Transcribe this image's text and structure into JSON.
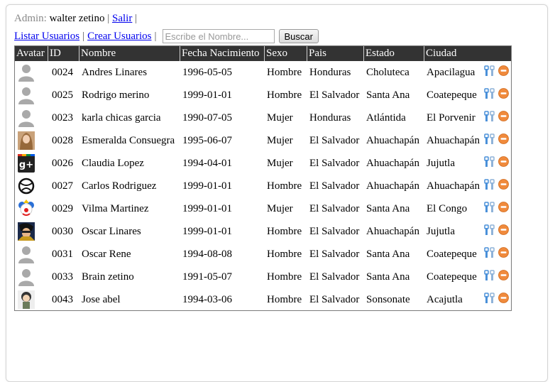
{
  "header": {
    "admin_label": "Admin:",
    "admin_name": "walter zetino",
    "separator": "|",
    "logout_link": "Salir"
  },
  "nav": {
    "list_users": "Listar Usuarios",
    "create_users": "Crear Usuarios",
    "search_placeholder": "Escribe el Nombre...",
    "search_value": "",
    "search_button": "Buscar"
  },
  "table": {
    "columns": [
      "Avatar",
      "ID",
      "Nombre",
      "Fecha Nacimiento",
      "Sexo",
      "Pais",
      "Estado",
      "Ciudad"
    ],
    "rows": [
      {
        "avatar": "default-user-icon",
        "id": "0024",
        "nombre": "Andres Linares",
        "fecha": "1996-05-05",
        "sexo": "Hombre",
        "pais": "Honduras",
        "estado": "Choluteca",
        "ciudad": "Apacilagua"
      },
      {
        "avatar": "default-user-icon",
        "id": "0025",
        "nombre": "Rodrigo merino",
        "fecha": "1999-01-01",
        "sexo": "Hombre",
        "pais": "El Salvador",
        "estado": "Santa Ana",
        "ciudad": "Coatepeque"
      },
      {
        "avatar": "default-user-icon",
        "id": "0023",
        "nombre": "karla chicas garcia",
        "fecha": "1990-07-05",
        "sexo": "Mujer",
        "pais": "Honduras",
        "estado": "Atlántida",
        "ciudad": "El Porvenir"
      },
      {
        "avatar": "woman-photo",
        "id": "0028",
        "nombre": "Esmeralda Consuegra",
        "fecha": "1995-06-07",
        "sexo": "Mujer",
        "pais": "El Salvador",
        "estado": "Ahuachapán",
        "ciudad": "Ahuachapán"
      },
      {
        "avatar": "google-plus-logo",
        "id": "0026",
        "nombre": "Claudia Lopez",
        "fecha": "1994-04-01",
        "sexo": "Mujer",
        "pais": "El Salvador",
        "estado": "Ahuachapán",
        "ciudad": "Jujutla"
      },
      {
        "avatar": "globe-logo",
        "id": "0027",
        "nombre": "Carlos Rodriguez",
        "fecha": "1999-01-01",
        "sexo": "Hombre",
        "pais": "El Salvador",
        "estado": "Ahuachapán",
        "ciudad": "Ahuachapán"
      },
      {
        "avatar": "clown-image",
        "id": "0029",
        "nombre": "Vilma Martinez",
        "fecha": "1999-01-01",
        "sexo": "Mujer",
        "pais": "El Salvador",
        "estado": "Santa Ana",
        "ciudad": "El Congo"
      },
      {
        "avatar": "cartoon-photo",
        "id": "0030",
        "nombre": "Oscar Linares",
        "fecha": "1999-01-01",
        "sexo": "Hombre",
        "pais": "El Salvador",
        "estado": "Ahuachapán",
        "ciudad": "Jujutla"
      },
      {
        "avatar": "default-user-icon",
        "id": "0031",
        "nombre": "Oscar Rene",
        "fecha": "1994-08-08",
        "sexo": "Hombre",
        "pais": "El Salvador",
        "estado": "Santa Ana",
        "ciudad": "Coatepeque"
      },
      {
        "avatar": "default-user-icon",
        "id": "0033",
        "nombre": "Brain zetino",
        "fecha": "1991-05-07",
        "sexo": "Hombre",
        "pais": "El Salvador",
        "estado": "Santa Ana",
        "ciudad": "Coatepeque"
      },
      {
        "avatar": "cartoon-character",
        "id": "0043",
        "nombre": "Jose abel",
        "fecha": "1994-03-06",
        "sexo": "Hombre",
        "pais": "El Salvador",
        "estado": "Sonsonate",
        "ciudad": "Acajutla"
      }
    ],
    "row_actions": {
      "edit_icon": "wrench-edit-icon",
      "delete_icon": "delete-minus-icon"
    }
  },
  "colors": {
    "header_bg": "#333333",
    "link": "#0000ee",
    "delete_orange": "#f08a3c",
    "edit_blue": "#4a90d9"
  }
}
